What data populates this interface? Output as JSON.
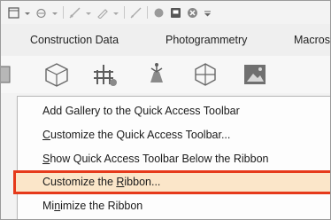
{
  "qat": {
    "icons": [
      "app-menu-icon",
      "undo-icon",
      "dropdown-arrow-icon",
      "measure-icon",
      "pen-icon",
      "draw-icon",
      "circle-icon",
      "save-icon",
      "close-icon",
      "qat-overflow-icon"
    ]
  },
  "tabs": [
    {
      "label": "Construction Data"
    },
    {
      "label": "Photogrammetry"
    },
    {
      "label": "Macros"
    }
  ],
  "ribbon": {
    "icons": [
      "partial-shape-icon",
      "box-icon",
      "plant-icon",
      "scan-icon",
      "hex-icon",
      "picture-icon"
    ]
  },
  "menu": {
    "items": [
      {
        "label": "Add Gallery to the Quick Access Toolbar"
      },
      {
        "pre": "",
        "key": "C",
        "post": "ustomize the Quick Access Toolbar..."
      },
      {
        "pre": "",
        "key": "S",
        "post": "how Quick Access Toolbar Below the Ribbon"
      },
      {
        "pre": "Customize the ",
        "key": "R",
        "post": "ibbon..."
      },
      {
        "pre": "Mi",
        "key": "n",
        "post": "imize the Ribbon"
      }
    ]
  },
  "colors": {
    "highlight_fill": "#fbe6c9",
    "highlight_border": "#e63a1b"
  }
}
